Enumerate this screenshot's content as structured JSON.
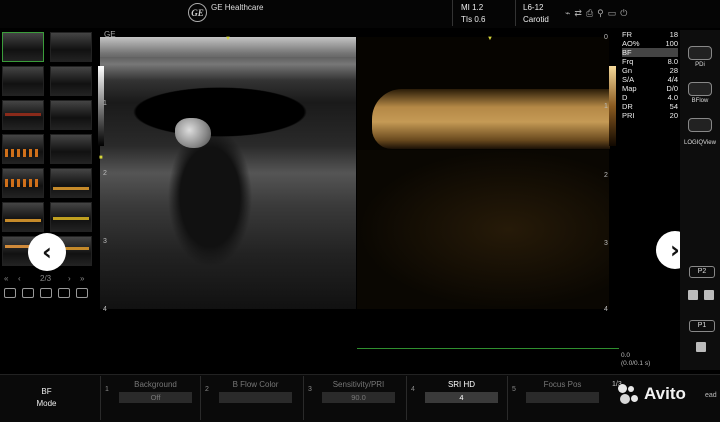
{
  "header": {
    "logo_text": "GE",
    "brand": "GE Healthcare",
    "mi": "MI 1.2",
    "tis": "TIs 0.6",
    "probe": "L6-12",
    "preset": "Carotid",
    "status_icons": [
      "usb-icon",
      "network-icon",
      "printer-icon",
      "battery-icon",
      "power-icon"
    ]
  },
  "thumbnails": {
    "pager_prev_all": "«",
    "pager_prev": "‹",
    "page": "2/3",
    "pager_next": "›",
    "pager_next_all": "»"
  },
  "navigation": {
    "prev": "‹",
    "next": "›"
  },
  "image": {
    "label": "GE",
    "depth_ticks": [
      "1",
      "2",
      "3",
      "4"
    ],
    "bf_depth_ticks": [
      "0",
      "1",
      "2",
      "3",
      "4"
    ]
  },
  "parameters": [
    {
      "label": "FR",
      "value": "18"
    },
    {
      "label": "AO%",
      "value": "100"
    },
    {
      "label": "BF",
      "value": ""
    },
    {
      "label": "Frq",
      "value": "8.0"
    },
    {
      "label": "Gn",
      "value": "28"
    },
    {
      "label": "S/A",
      "value": "4/4"
    },
    {
      "label": "Map",
      "value": "D/0"
    },
    {
      "label": "D",
      "value": "4.0"
    },
    {
      "label": "DR",
      "value": "54"
    },
    {
      "label": "PRI",
      "value": "20"
    }
  ],
  "readout": {
    "line1": "0.0",
    "line2": "(0.0/0.1 s)"
  },
  "right_panel": {
    "pdi": "PDi",
    "bflow": "BFlow",
    "logiqview": "LOGIQView",
    "p2": "P2",
    "p1": "P1"
  },
  "bottom": {
    "mode_line1": "BF",
    "mode_line2": "Mode",
    "slots": [
      {
        "num": "1",
        "title": "Background",
        "value": "Off"
      },
      {
        "num": "2",
        "title": "B Flow Color",
        "value": ""
      },
      {
        "num": "3",
        "title": "Sensitivity/PRI",
        "value": "90.0"
      },
      {
        "num": "4",
        "title": "SRI HD",
        "value": "4"
      },
      {
        "num": "5",
        "title": "Focus Pos",
        "value": ""
      }
    ],
    "page_indicator_top": "1/3",
    "page_indicator_bottom": "",
    "watermark": "Avito",
    "trailing_text": "ead"
  }
}
